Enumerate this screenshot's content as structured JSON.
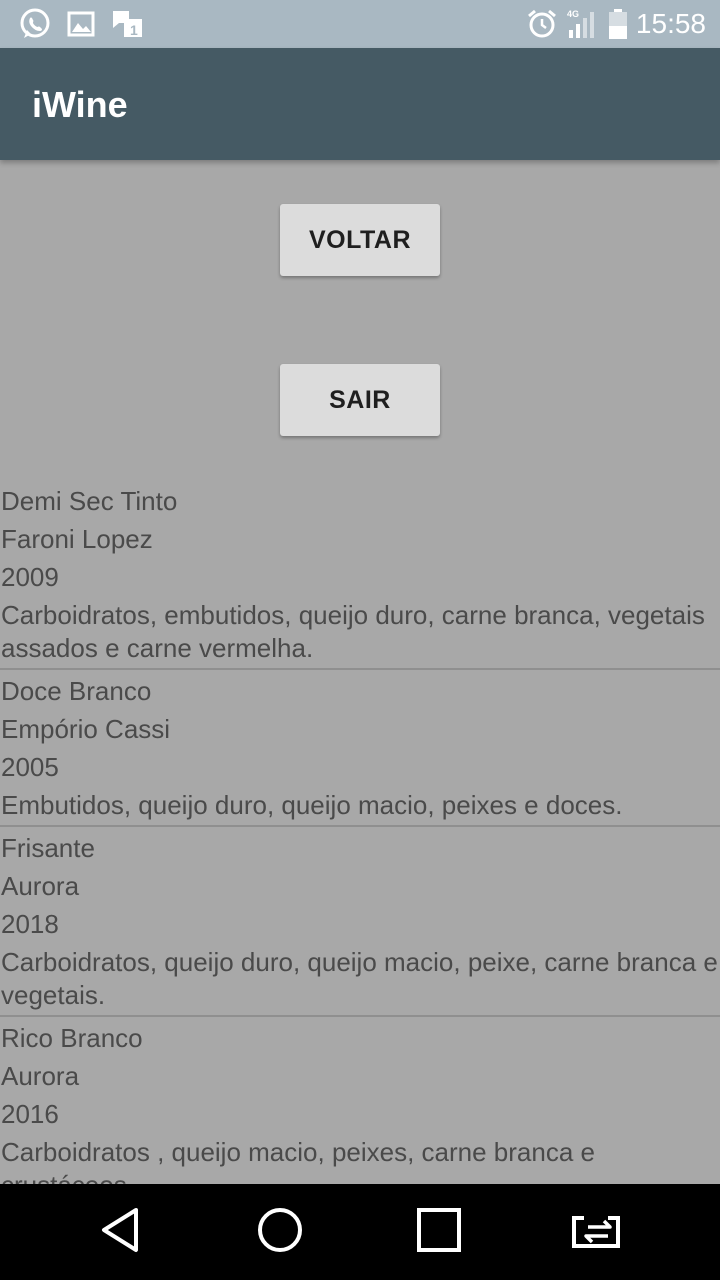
{
  "status_bar": {
    "time": "15:58",
    "icons": [
      "whatsapp-icon",
      "image-icon",
      "message-icon",
      "alarm-icon",
      "signal-4g-icon",
      "battery-icon"
    ],
    "network_label": "4G"
  },
  "app_bar": {
    "title": "iWine"
  },
  "buttons": {
    "back_label": "VOLTAR",
    "exit_label": "SAIR"
  },
  "wines": [
    {
      "name": "Demi Sec Tinto",
      "producer": "Faroni Lopez",
      "year": "2009",
      "pairing": "Carboidratos, embutidos, queijo duro, carne branca, vegetais assados e carne vermelha."
    },
    {
      "name": "Doce Branco",
      "producer": "Empório Cassi",
      "year": "2005",
      "pairing": "Embutidos, queijo duro, queijo macio, peixes e doces."
    },
    {
      "name": "Frisante",
      "producer": "Aurora",
      "year": "2018",
      "pairing": "Carboidratos, queijo duro, queijo macio, peixe, carne branca e vegetais."
    },
    {
      "name": "Rico Branco",
      "producer": "Aurora",
      "year": "2016",
      "pairing": "Carboidratos , queijo macio, peixes, carne branca e crustáceos."
    }
  ],
  "nav_bar": {
    "icons": [
      "back-icon",
      "home-icon",
      "recents-icon",
      "switch-app-icon"
    ]
  },
  "colors": {
    "status_bar": "#a9b8c2",
    "app_bar": "#455a64",
    "background": "#a8a8a8",
    "button": "#dcdcdc",
    "nav_bar": "#000000"
  }
}
